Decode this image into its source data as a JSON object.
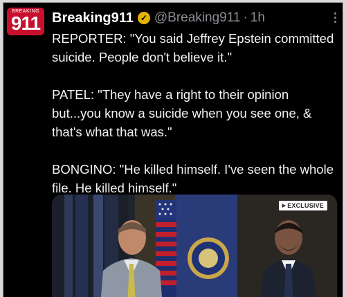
{
  "account": {
    "avatar_top": "BREAKING",
    "avatar_number": "911",
    "name": "Breaking911",
    "handle": "@Breaking911",
    "separator": "·",
    "time": "1h"
  },
  "tweet": {
    "paragraphs": [
      "REPORTER: \"You said Jeffrey Epstein committed suicide. People don't believe it.\"",
      "PATEL: \"They have a right to their opinion but...you know a suicide when you see one, & that's what that was.\"",
      "BONGINO: \"He killed himself. I've seen the whole file. He killed himself.\""
    ]
  },
  "media": {
    "badge": "EXCLUSIVE",
    "badge_arrow": "▶"
  },
  "colors": {
    "background": "#000000",
    "brand_red": "#c8102e",
    "verified_gold": "#e5b200",
    "muted": "#8b8f94"
  },
  "icons": {
    "verified": "verified-badge-icon",
    "more": "more-options-icon"
  }
}
